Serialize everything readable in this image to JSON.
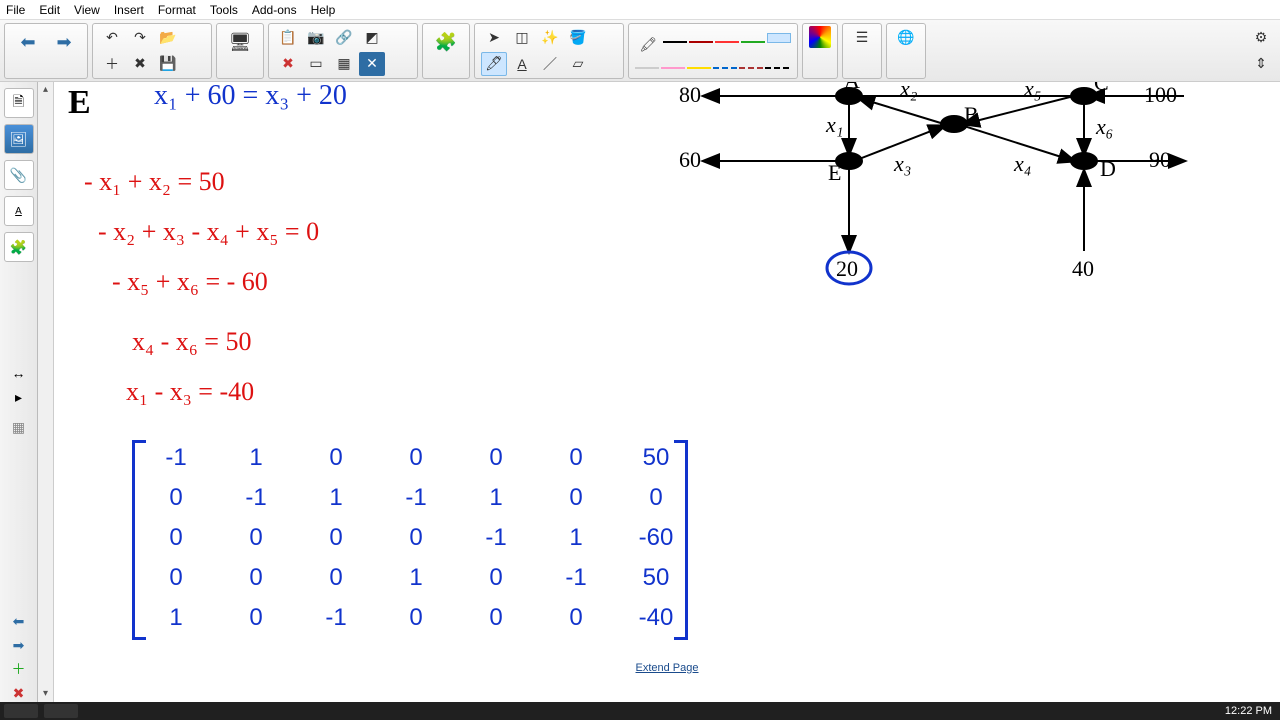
{
  "menu": {
    "file": "File",
    "edit": "Edit",
    "view": "View",
    "insert": "Insert",
    "format": "Format",
    "tools": "Tools",
    "addons": "Add-ons",
    "help": "Help"
  },
  "extend_label": "Extend Page",
  "clock": "12:22 PM",
  "equations": {
    "header_letter": "E",
    "top_blue": "x₁ + 60 =     x₃ + 20",
    "r1": "- x₁ + x₂ = 50",
    "r2": "- x₂ + x₃ - x₄ + x₅ = 0",
    "r3": "- x₅ + x₆  =  - 60",
    "r4": "x₄ - x₆ = 50",
    "r5": "x₁ - x₃ = -40"
  },
  "matrix": {
    "rows": [
      [
        "-1",
        "1",
        "0",
        "0",
        "0",
        "0",
        "50"
      ],
      [
        "0",
        "-1",
        "1",
        "-1",
        "1",
        "0",
        "0"
      ],
      [
        "0",
        "0",
        "0",
        "0",
        "-1",
        "1",
        "-60"
      ],
      [
        "0",
        "0",
        "0",
        "1",
        "0",
        "-1",
        "50"
      ],
      [
        "1",
        "0",
        "-1",
        "0",
        "0",
        "0",
        "-40"
      ]
    ]
  },
  "diagram": {
    "outer": {
      "left": "80",
      "right": "100",
      "in_left": "60",
      "out_right": "90",
      "bottom_e": "20",
      "bottom_d": "40"
    },
    "vars": {
      "x1": "x₁",
      "x2": "x₂",
      "x3": "x₃",
      "x4": "x₄",
      "x5": "x₅",
      "x6": "x₆"
    },
    "nodes": {
      "A": "A",
      "B": "B",
      "C": "C",
      "D": "D",
      "E": "E"
    }
  }
}
